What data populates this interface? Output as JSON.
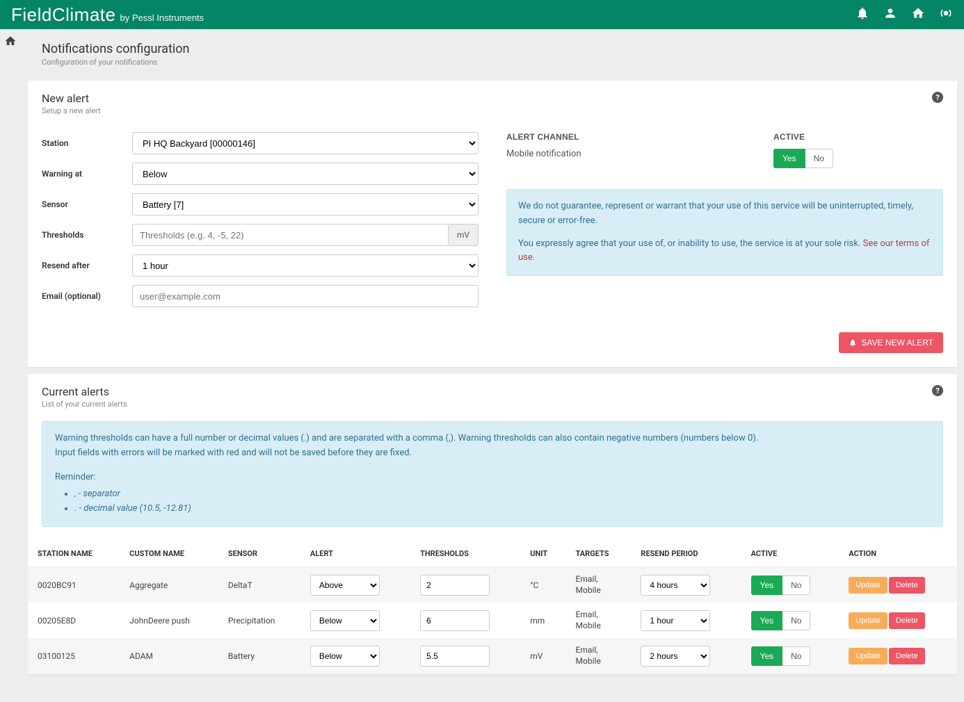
{
  "brand": {
    "main": "FieldClimate",
    "sub": "by Pessl Instruments"
  },
  "page": {
    "title": "Notifications configuration",
    "subtitle": "Configuration of your notifications"
  },
  "newAlert": {
    "title": "New alert",
    "subtitle": "Setup a new alert",
    "labels": {
      "station": "Station",
      "warning": "Warning at",
      "sensor": "Sensor",
      "thresholds": "Thresholds",
      "resend": "Resend after",
      "email": "Email (optional)"
    },
    "values": {
      "station": "PI HQ Backyard [00000146]",
      "warning": "Below",
      "sensor": "Battery [7]",
      "resend": "1 hour"
    },
    "placeholders": {
      "thresholds": "Thresholds (e.g. 4, -5, 22)",
      "email": "user@example.com"
    },
    "unitAddon": "mV",
    "channelSectionLabel": "ALERT CHANNEL",
    "activeSectionLabel": "ACTIVE",
    "channelName": "Mobile notification",
    "toggles": {
      "yes": "Yes",
      "no": "No"
    },
    "disclaimer1": "We do not guarantee, represent or warrant that your use of this service will be uninterrupted, timely, secure or error-free.",
    "disclaimer2": "You expressly agree that your use of, or inability to use, the service is at your sole risk. ",
    "termsLink": "See our terms of use",
    "saveBtn": "SAVE NEW ALERT"
  },
  "currentAlerts": {
    "title": "Current alerts",
    "subtitle": "List of your current alerts",
    "info": {
      "line1": "Warning thresholds can have a full number or decimal values (.) and are separated with a comma (,). Warning thresholds can also contain negative numbers (numbers below 0).",
      "line2": "Input fields with errors will be marked with red and will not be saved before they are fixed.",
      "reminder": "Reminder:",
      "bullet1": ", - separator",
      "bullet2": ". - decimal value (10.5, -12.81)"
    },
    "headers": {
      "station": "STATION NAME",
      "custom": "CUSTOM NAME",
      "sensor": "SENSOR",
      "alert": "ALERT",
      "thresholds": "THRESHOLDS",
      "unit": "UNIT",
      "targets": "TARGETS",
      "resend": "RESEND PERIOD",
      "active": "ACTIVE",
      "action": "ACTION"
    },
    "rows": [
      {
        "station": "0020BC91",
        "custom": "Aggregate",
        "sensor": "DeltaT",
        "alert": "Above",
        "thresholds": "2",
        "unit": "°C",
        "targets": "Email, Mobile",
        "resend": "4 hours",
        "active": true
      },
      {
        "station": "00205E8D",
        "custom": "JohnDeere push",
        "sensor": "Precipitation",
        "alert": "Below",
        "thresholds": "6",
        "unit": "mm",
        "targets": "Email, Mobile",
        "resend": "1 hour",
        "active": true
      },
      {
        "station": "03100125",
        "custom": "ADAM",
        "sensor": "Battery",
        "alert": "Below",
        "thresholds": "5.5",
        "unit": "mV",
        "targets": "Email, Mobile",
        "resend": "2 hours",
        "active": true
      }
    ],
    "buttons": {
      "update": "Update",
      "delete": "Delete"
    }
  },
  "colors": {
    "primary": "#048565",
    "save": "#ed5565",
    "update": "#f8ac59",
    "active": "#1aaa55"
  }
}
